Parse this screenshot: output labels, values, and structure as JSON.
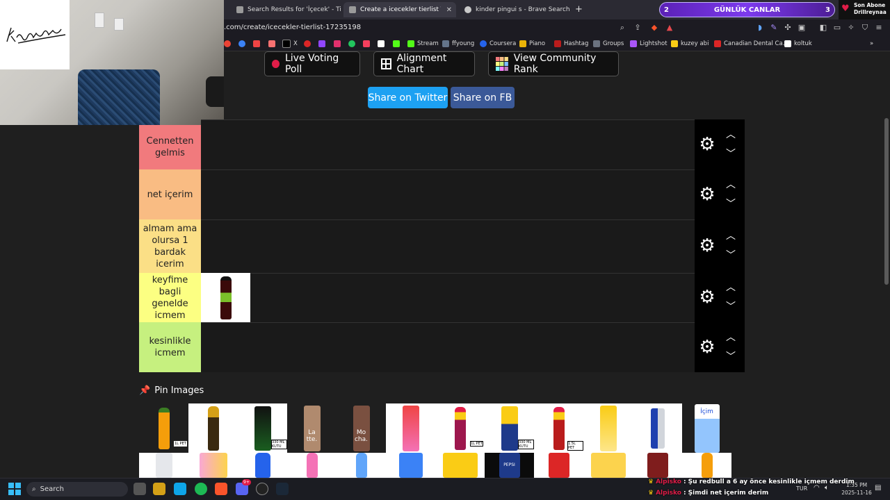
{
  "browser": {
    "tabs": [
      {
        "title": "Search Results for 'İçecek' - TierMaker",
        "active": false
      },
      {
        "title": "Create a icecekler tierlist Tier List",
        "active": true
      },
      {
        "title": "kinder pingui s - Brave Search",
        "active": false
      }
    ],
    "new_tab": "+",
    "url": ".com/create/icecekler-tierlist-17235198",
    "bookmarks": [
      "X",
      "Stream",
      "ffyoung",
      "Coursera",
      "Piano",
      "Hashtag",
      "Groups",
      "Lightshot",
      "kuzey abi",
      "Canadian Dental Ca...",
      "koltuk"
    ],
    "more": "»"
  },
  "stream": {
    "goal_left": "2",
    "goal_label": "GÜNLÜK CANLAR",
    "goal_right": "3",
    "sub_title": "Son Abone",
    "sub_name": "Drillreynaa"
  },
  "page": {
    "buttons": {
      "live_voting": "Live Voting Poll",
      "alignment": "Alignment Chart",
      "community": "View Community Rank",
      "share_twitter": "Share on Twitter",
      "share_fb": "Share on FB"
    },
    "tiers": [
      {
        "label": "Cennetten gelmis",
        "color": "#f17a7d"
      },
      {
        "label": "net içerim",
        "color": "#f9bc83"
      },
      {
        "label": "almam ama olursa 1 bardak icerim",
        "color": "#fbdf86"
      },
      {
        "label": "keyfime bagli genelde icmem",
        "color": "#fcff82"
      },
      {
        "label": "kesinlikle icmem",
        "color": "#c6f07f"
      }
    ],
    "pin_images": "Pin Images",
    "tile_labels": {
      "pet_1l": "1L PET",
      "kutu_330": "330 ML KUTU",
      "latte": "La tte.",
      "mocha": "Mo cha.",
      "pet_1l_2": "1L PET",
      "kutu_330_2": "330 ML KUTU",
      "pet_15": "1.5L PET",
      "pepsi": "PEPSI",
      "icim": "İçim"
    }
  },
  "taskbar": {
    "search": "Search",
    "chat": [
      {
        "user": "Alpisko",
        "message": ": Şu redbull a 6 ay önce kesinlikle içmem derdim"
      },
      {
        "user": "Alpisko",
        "message": ": Şimdi net içerim derim"
      }
    ],
    "lang": "TUR",
    "time": "1:35 PM",
    "date": "2025-11-16",
    "discord_badge": "9+"
  }
}
